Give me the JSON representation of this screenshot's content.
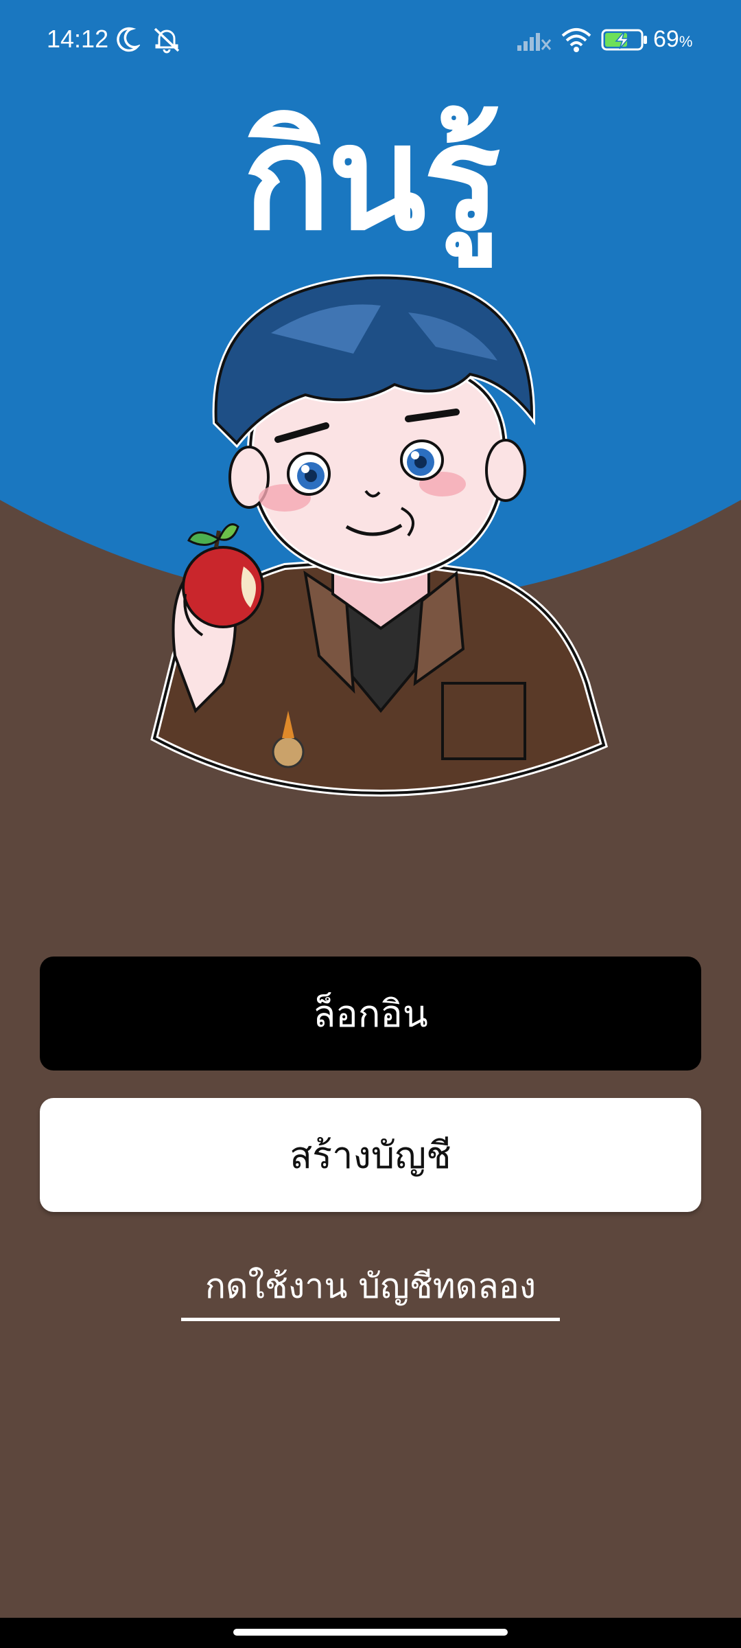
{
  "status_bar": {
    "time": "14:12",
    "battery_percent": "69",
    "battery_unit": "%",
    "icons": [
      "moon-icon",
      "bell-muted-icon",
      "signal-icon",
      "wifi-icon",
      "battery-charging-icon"
    ]
  },
  "app": {
    "title": "กินรู้"
  },
  "actions": {
    "login_label": "ล็อกอิน",
    "register_label": "สร้างบัญชี",
    "demo_label": "กดใช้งาน บัญชีทดลอง"
  },
  "colors": {
    "top_blue": "#1a77c0",
    "background_brown": "#5d473d",
    "login_button": "#000000",
    "register_button": "#ffffff"
  }
}
